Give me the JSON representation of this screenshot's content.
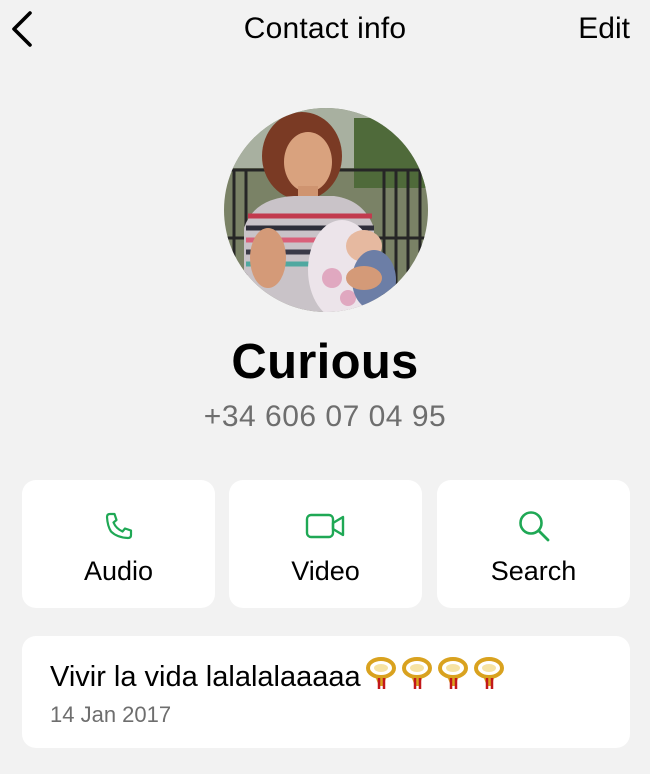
{
  "nav": {
    "title": "Contact info",
    "edit_label": "Edit",
    "back_icon": "chevron-left-icon"
  },
  "contact": {
    "name": "Curious",
    "phone": "+34 606 07 04 95"
  },
  "actions": [
    {
      "label": "Audio",
      "icon": "phone-icon"
    },
    {
      "label": "Video",
      "icon": "video-camera-icon"
    },
    {
      "label": "Search",
      "icon": "search-icon"
    }
  ],
  "about": {
    "status": "Vivir la vida lalalalaaaaa",
    "emoji": "postal-horn",
    "emoji_count": 4,
    "date": "14 Jan 2017"
  },
  "colors": {
    "background": "#f2f2f2",
    "card": "#ffffff",
    "accent_green": "#1fa855",
    "secondary_text": "#6e6e6e"
  }
}
